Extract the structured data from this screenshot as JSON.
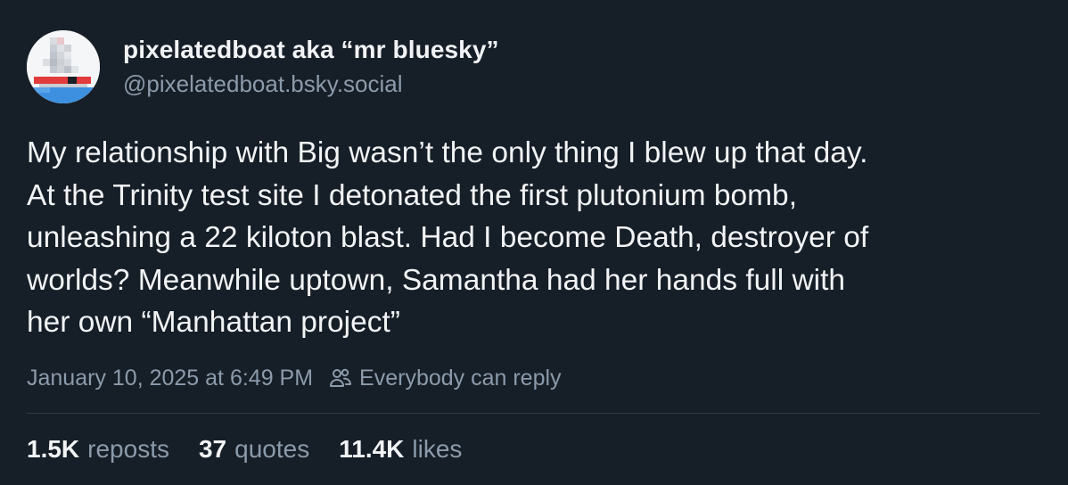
{
  "author": {
    "display_name": "pixelatedboat aka “mr bluesky”",
    "handle": "@pixelatedboat.bsky.social",
    "avatar_icon": "pixelated-boat-avatar"
  },
  "post": {
    "text": "My relationship with Big wasn’t the only thing I blew up that day.\nAt the Trinity test site I detonated the first plutonium bomb,\nunleashing a 22 kiloton blast. Had I become Death, destroyer of\nworlds? Meanwhile uptown, Samantha had her hands full with\nher own “Manhattan project”",
    "timestamp": "January 10, 2025 at 6:49 PM",
    "reply_setting": "Everybody can reply",
    "reply_icon": "people-icon"
  },
  "stats": {
    "reposts_count": "1.5K",
    "reposts_label": "reposts",
    "quotes_count": "37",
    "quotes_label": "quotes",
    "likes_count": "11.4K",
    "likes_label": "likes"
  },
  "colors": {
    "background": "#161e27",
    "text": "#f1f3f5",
    "muted": "#8c9bab",
    "divider": "#2e3a48"
  }
}
